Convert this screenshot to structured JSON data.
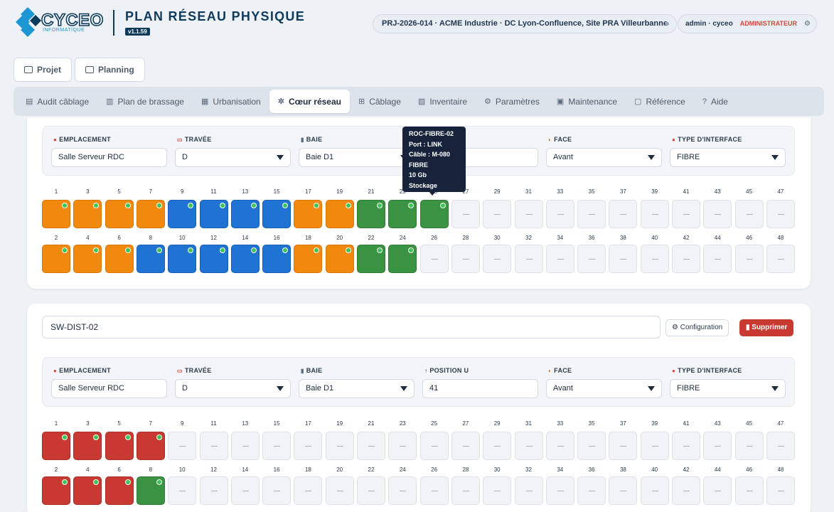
{
  "header": {
    "title": "PLAN RÉSEAU PHYSIQUE",
    "version": "v1.1.59",
    "project": "PRJ-2026-014 · ACME Industrie · DC Lyon-Confluence, Site PRA Villeurbanne",
    "user": "admin · cyceo",
    "role": "ADMINISTRATEUR",
    "logo_text": "CYCEO",
    "logo_sub": "INFORMATIQUE"
  },
  "top_buttons": [
    {
      "label": "Projet",
      "icon": "folder-icon"
    },
    {
      "label": "Planning",
      "icon": "calendar-icon"
    }
  ],
  "nav": [
    {
      "label": "Audit câblage",
      "icon": "audit-icon",
      "active": false
    },
    {
      "label": "Plan de brassage",
      "icon": "patch-plan-icon",
      "active": false
    },
    {
      "label": "Urbanisation",
      "icon": "building-icon",
      "active": false
    },
    {
      "label": "Cœur réseau",
      "icon": "network-core-icon",
      "active": true
    },
    {
      "label": "Câblage",
      "icon": "cable-icon",
      "active": false
    },
    {
      "label": "Inventaire",
      "icon": "inventory-icon",
      "active": false
    },
    {
      "label": "Paramètres",
      "icon": "gear-icon",
      "active": false
    },
    {
      "label": "Maintenance",
      "icon": "save-icon",
      "active": false
    },
    {
      "label": "Référence",
      "icon": "reference-icon",
      "active": false
    },
    {
      "label": "Aide",
      "icon": "help-icon",
      "active": false
    }
  ],
  "labels": {
    "emplacement": "EMPLACEMENT",
    "travee": "TRAVÉE",
    "baie": "BAIE",
    "position": "POSITION U",
    "face": "FACE",
    "type": "TYPE D'INTERFACE",
    "empty_port": "—"
  },
  "card1": {
    "emplacement": "Salle Serveur RDC",
    "travee": "D",
    "baie": "Baie D1",
    "position": "",
    "face": "Avant",
    "type": "FIBRE",
    "ports_top": [
      "orange",
      "orange",
      "orange",
      "orange",
      "blue",
      "blue",
      "blue",
      "blue",
      "orange",
      "orange",
      "green",
      "green",
      "green",
      "empty",
      "empty",
      "empty",
      "empty",
      "empty",
      "empty",
      "empty",
      "empty",
      "empty",
      "empty",
      "empty"
    ],
    "ports_bottom": [
      "orange",
      "orange",
      "orange",
      "blue",
      "blue",
      "blue",
      "blue",
      "blue",
      "orange",
      "orange",
      "green",
      "green",
      "empty",
      "empty",
      "empty",
      "empty",
      "empty",
      "empty",
      "empty",
      "empty",
      "empty",
      "empty",
      "empty",
      "empty"
    ]
  },
  "tooltip": {
    "lines": [
      "ROC-FIBRE-02",
      "Port : LINK",
      "Câble : M-080",
      "FIBRE",
      "10 Gb",
      "Stockage"
    ]
  },
  "card2": {
    "name": "SW-DIST-02",
    "config_label": "Configuration",
    "delete_label": "Supprimer",
    "emplacement": "Salle Serveur RDC",
    "travee": "D",
    "baie": "Baie D1",
    "position": "41",
    "face": "Avant",
    "type": "FIBRE",
    "ports_top": [
      "red",
      "red",
      "red",
      "red",
      "empty",
      "empty",
      "empty",
      "empty",
      "empty",
      "empty",
      "empty",
      "empty",
      "empty",
      "empty",
      "empty",
      "empty",
      "empty",
      "empty",
      "empty",
      "empty",
      "empty",
      "empty",
      "empty",
      "empty"
    ],
    "ports_bottom": [
      "red",
      "red",
      "red",
      "green",
      "empty",
      "empty",
      "empty",
      "empty",
      "empty",
      "empty",
      "empty",
      "empty",
      "empty",
      "empty",
      "empty",
      "empty",
      "empty",
      "empty",
      "empty",
      "empty",
      "empty",
      "empty",
      "empty",
      "empty"
    ]
  },
  "colors": {
    "brand": "#0e3a5c",
    "orange": "#f2890f",
    "blue": "#1f73d2",
    "green": "#3a9243",
    "red": "#c83a31",
    "led": "#3dc456"
  }
}
